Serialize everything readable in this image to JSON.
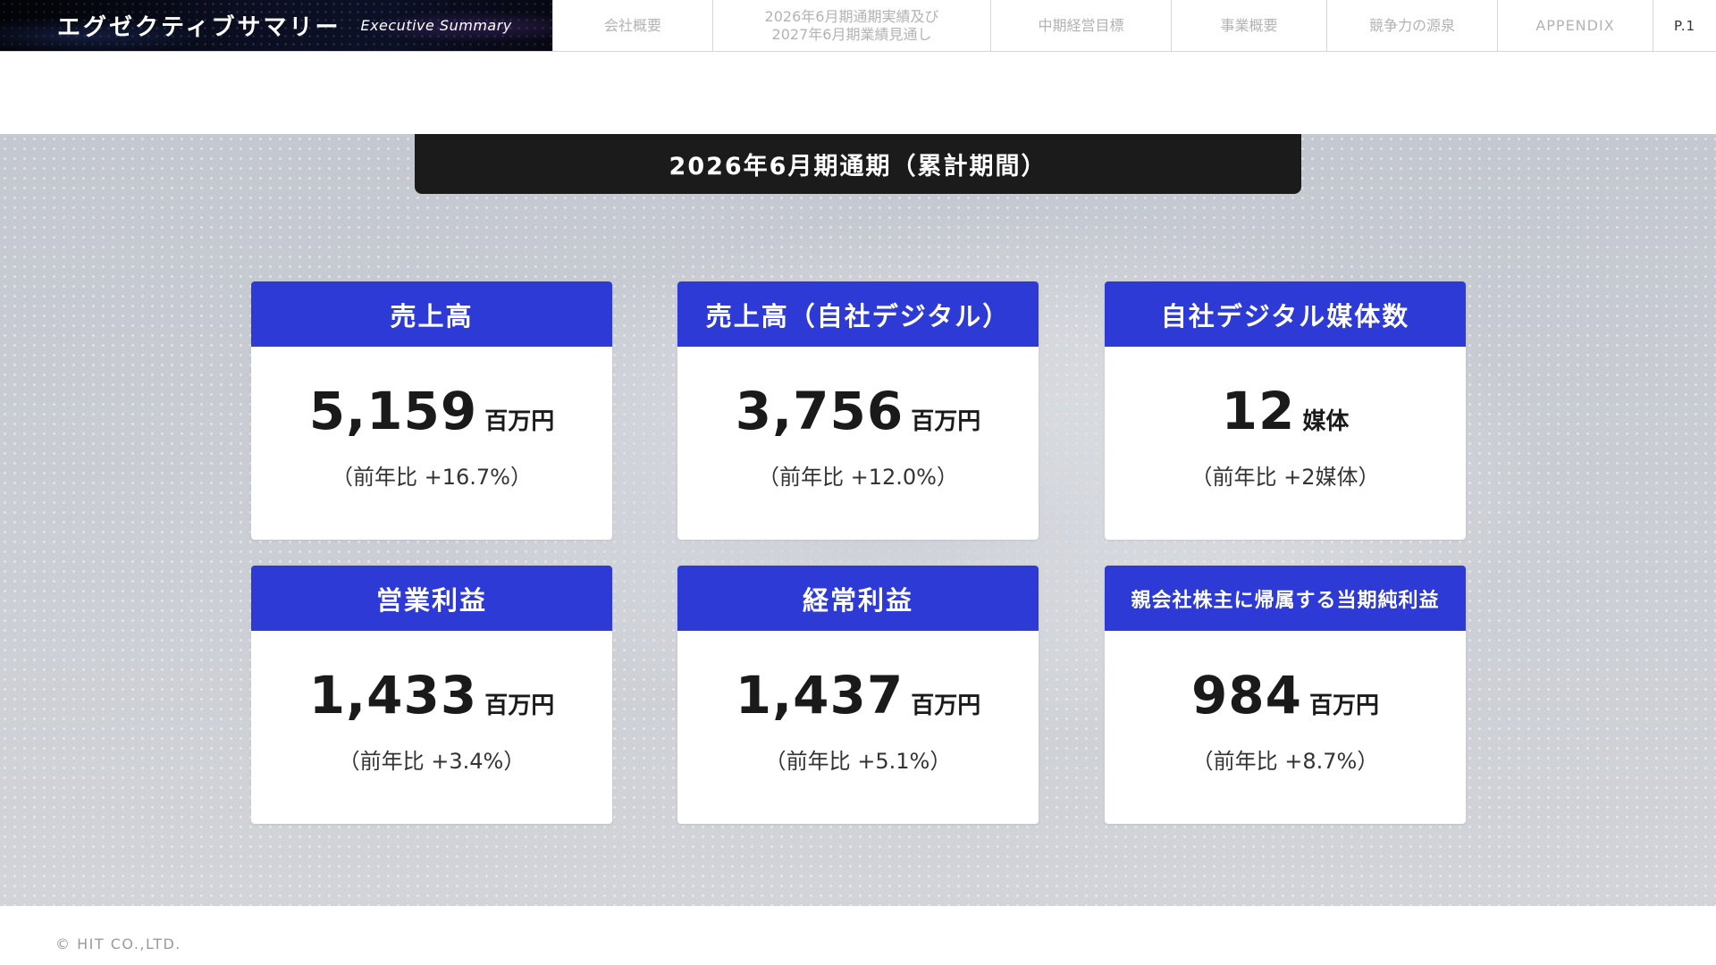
{
  "header": {
    "title_jp": "エグゼクティブサマリー",
    "title_en": "Executive Summary",
    "nav": [
      {
        "label": "会社概要"
      },
      {
        "label": "2026年6月期通期実績及び\n2027年6月期業績見通し"
      },
      {
        "label": "中期経営目標"
      },
      {
        "label": "事業概要"
      },
      {
        "label": "競争力の源泉"
      },
      {
        "label": "APPENDIX"
      }
    ],
    "page": "P.1"
  },
  "banner": "2026年6月期通期（累計期間）",
  "cards": [
    {
      "title": "売上高",
      "value": "5,159",
      "unit": "百万円",
      "yoy": "（前年比 +16.7%）"
    },
    {
      "title": "売上高（自社デジタル）",
      "value": "3,756",
      "unit": "百万円",
      "yoy": "（前年比 +12.0%）"
    },
    {
      "title": "自社デジタル媒体数",
      "value": "12",
      "unit": "媒体",
      "yoy": "（前年比 +2媒体）"
    },
    {
      "title": "営業利益",
      "value": "1,433",
      "unit": "百万円",
      "yoy": "（前年比 +3.4%）"
    },
    {
      "title": "経常利益",
      "value": "1,437",
      "unit": "百万円",
      "yoy": "（前年比 +5.1%）"
    },
    {
      "title": "親会社株主に帰属する当期純利益",
      "value": "984",
      "unit": "百万円",
      "yoy": "（前年比 +8.7%）"
    }
  ],
  "footer": "© HIT CO.,LTD.",
  "colors": {
    "card_header": "#2d3ad6",
    "banner": "#1b1b1b",
    "nav_text": "#b3b3b3"
  }
}
